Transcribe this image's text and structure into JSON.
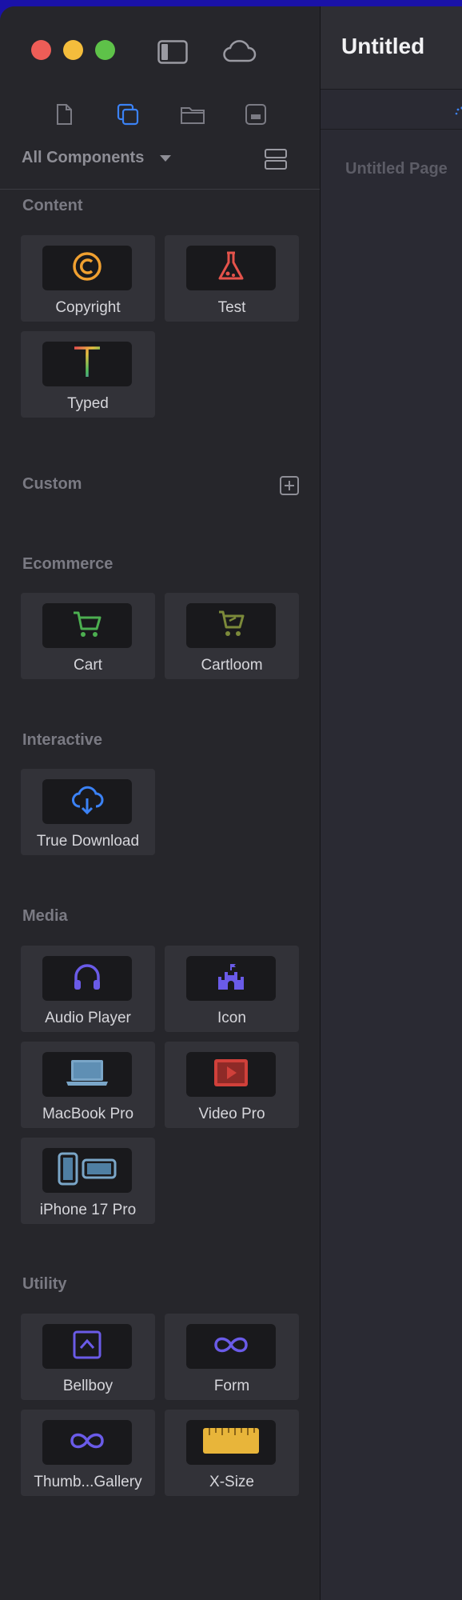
{
  "window": {
    "title": "Untitled"
  },
  "main": {
    "page_label": "Untitled Page"
  },
  "toolbar": {
    "icons": [
      "sidebar-toggle-icon",
      "cloud-icon"
    ]
  },
  "tabs": {
    "icons": [
      "document-icon",
      "components-icon",
      "folder-icon",
      "media-icon"
    ],
    "active": "components-icon"
  },
  "filter": {
    "label": "All Components"
  },
  "sections": {
    "content": {
      "title": "Content",
      "items": [
        {
          "label": "Copyright"
        },
        {
          "label": "Test"
        },
        {
          "label": "Typed"
        }
      ]
    },
    "custom": {
      "title": "Custom"
    },
    "ecommerce": {
      "title": "Ecommerce",
      "items": [
        {
          "label": "Cart"
        },
        {
          "label": "Cartloom"
        }
      ]
    },
    "interactive": {
      "title": "Interactive",
      "items": [
        {
          "label": "True Download"
        }
      ]
    },
    "media": {
      "title": "Media",
      "items": [
        {
          "label": "Audio Player"
        },
        {
          "label": "Icon"
        },
        {
          "label": "MacBook Pro"
        },
        {
          "label": "Video Pro"
        },
        {
          "label": "iPhone 17 Pro"
        }
      ]
    },
    "utility": {
      "title": "Utility",
      "items": [
        {
          "label": "Bellboy"
        },
        {
          "label": "Form"
        },
        {
          "label": "Thumb...Gallery"
        },
        {
          "label": "X-Size"
        }
      ]
    }
  },
  "colors": {
    "accent": "#3b82f6",
    "copyright": "#f0a030",
    "test": "#e5534b",
    "cart": "#4caf50",
    "cartloom": "#7c8a3a",
    "download": "#3b82f6",
    "media": "#6a5be8",
    "laptop": "#7aa6c8",
    "video": "#d0403a",
    "ruler": "#e8b53a"
  }
}
